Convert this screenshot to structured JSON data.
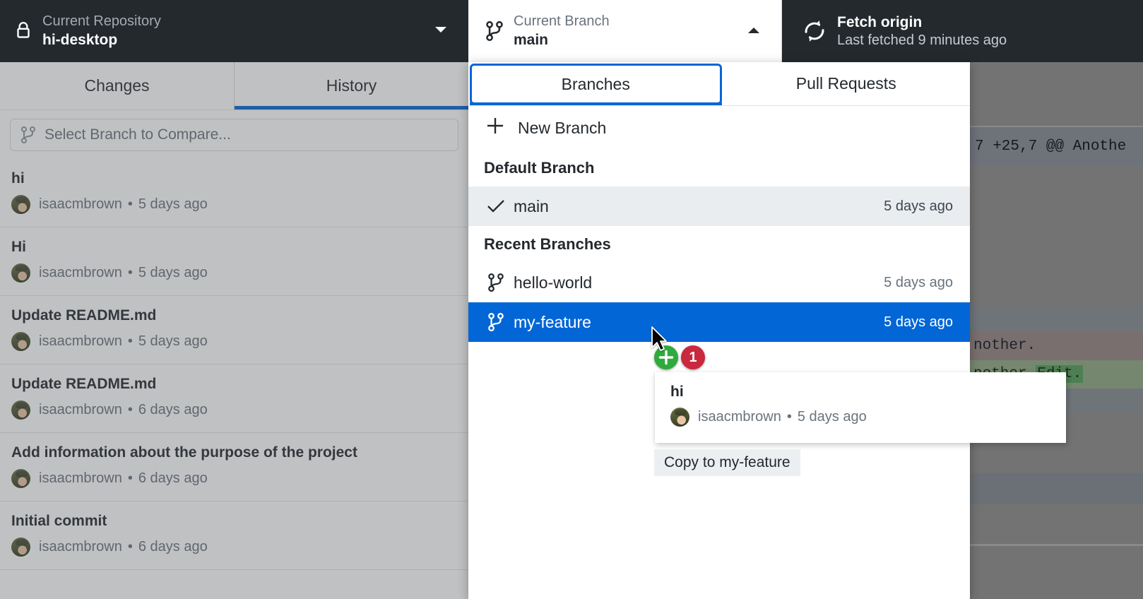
{
  "toolbar": {
    "repo": {
      "label": "Current Repository",
      "value": "hi-desktop",
      "icon": "lock-icon",
      "caret": "chevron-down-icon"
    },
    "branch": {
      "label": "Current Branch",
      "value": "main",
      "icon": "git-branch-icon",
      "caret": "chevron-up-icon"
    },
    "fetch": {
      "title": "Fetch origin",
      "subtitle": "Last fetched 9 minutes ago",
      "icon": "sync-icon"
    }
  },
  "sidebar": {
    "tabs": [
      {
        "label": "Changes",
        "active": false
      },
      {
        "label": "History",
        "active": true
      }
    ],
    "compare": {
      "placeholder": "Select Branch to Compare...",
      "icon": "git-branch-icon"
    },
    "commits": [
      {
        "title": "hi",
        "author": "isaacmbrown",
        "separator": "•",
        "date": "5 days ago"
      },
      {
        "title": "Hi",
        "author": "isaacmbrown",
        "separator": "•",
        "date": "5 days ago"
      },
      {
        "title": "Update README.md",
        "author": "isaacmbrown",
        "separator": "•",
        "date": "5 days ago"
      },
      {
        "title": "Update README.md",
        "author": "isaacmbrown",
        "separator": "•",
        "date": "6 days ago"
      },
      {
        "title": "Add information about the purpose of the project",
        "author": "isaacmbrown",
        "separator": "•",
        "date": "6 days ago"
      },
      {
        "title": "Initial commit",
        "author": "isaacmbrown",
        "separator": "•",
        "date": "6 days ago"
      }
    ]
  },
  "branch_foldout": {
    "tabs": [
      {
        "label": "Branches",
        "active": true
      },
      {
        "label": "Pull Requests",
        "active": false
      }
    ],
    "new_branch": {
      "label": "New Branch",
      "icon": "plus-icon"
    },
    "groups": [
      {
        "heading": "Default Branch",
        "rows": [
          {
            "name": "main",
            "date": "5 days ago",
            "icon": "check-icon",
            "state": "current"
          }
        ]
      },
      {
        "heading": "Recent Branches",
        "rows": [
          {
            "name": "hello-world",
            "date": "5 days ago",
            "icon": "git-branch-icon",
            "state": "normal"
          },
          {
            "name": "my-feature",
            "date": "5 days ago",
            "icon": "git-branch-icon",
            "state": "selected"
          }
        ]
      }
    ]
  },
  "drag": {
    "cursor_icon": "pointer-cursor-icon",
    "plus_badge": {
      "icon": "plus-icon",
      "color": "#2eab3c"
    },
    "count_badge": {
      "count": "1",
      "color": "#c9283e"
    },
    "card": {
      "title": "hi",
      "author": "isaacmbrown",
      "separator": "•",
      "date": "5 days ago"
    },
    "tooltip": "Copy to my-feature"
  },
  "diff": {
    "hunk_header": "7 +25,7 @@ Anothe",
    "context_line": "nother.",
    "added_line": "nother.",
    "added_highlight": "Edit."
  },
  "colors": {
    "accent": "#0366d6",
    "toolbar_bg": "#24292e",
    "selected_row": "#0366d6",
    "current_row": "#e9edf0",
    "success": "#2eab3c",
    "danger": "#c9283e"
  }
}
